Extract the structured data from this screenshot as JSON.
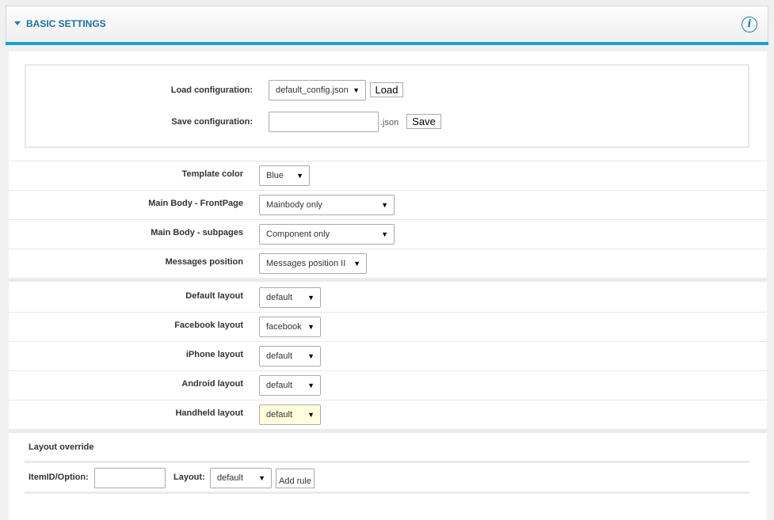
{
  "header": {
    "title": "BASIC SETTINGS",
    "info_glyph": "i"
  },
  "config": {
    "load_label": "Load configuration:",
    "load_value": "default_config.json",
    "load_button": "Load",
    "save_label": "Save configuration:",
    "save_value": "",
    "save_suffix": ".json",
    "save_button": "Save"
  },
  "settings": [
    {
      "label": "Template color",
      "value": "Blue"
    },
    {
      "label": "Main Body - FrontPage",
      "value": "Mainbody only"
    },
    {
      "label": "Main Body - subpages",
      "value": "Component only"
    },
    {
      "label": "Messages position",
      "value": "Messages position II"
    }
  ],
  "layouts": [
    {
      "label": "Default layout",
      "value": "default"
    },
    {
      "label": "Facebook layout",
      "value": "facebook"
    },
    {
      "label": "iPhone layout",
      "value": "default"
    },
    {
      "label": "Android layout",
      "value": "default"
    },
    {
      "label": "Handheld layout",
      "value": "default",
      "highlighted": true
    }
  ],
  "override": {
    "title": "Layout override",
    "itemid_label": "ItemID/Option:",
    "itemid_value": "",
    "layout_label": "Layout:",
    "layout_value": "default",
    "add_button": "Add rule"
  },
  "arrow_glyph": "▼",
  "colors": {
    "accent": "#1a9fd6",
    "title": "#1a6fa8",
    "highlight": "#ffffdd"
  }
}
